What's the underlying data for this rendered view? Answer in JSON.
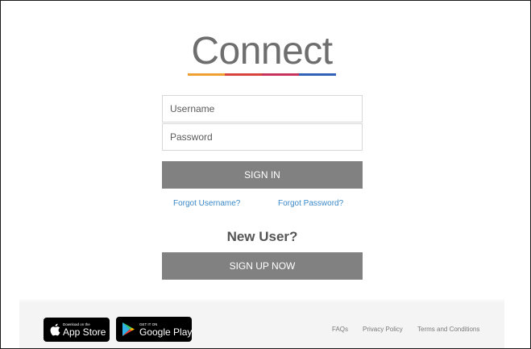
{
  "logo": {
    "text": "Connect",
    "bar_colors": [
      "#f0a030",
      "#d8433b",
      "#c8335c",
      "#2f62b8"
    ]
  },
  "login_form": {
    "username_placeholder": "Username",
    "password_placeholder": "Password",
    "sign_in_label": "SIGN IN",
    "forgot_username": "Forgot Username?",
    "forgot_password": "Forgot Password?"
  },
  "signup": {
    "heading": "New User?",
    "button_label": "SIGN UP NOW"
  },
  "footer": {
    "app_store": {
      "small": "Download on the",
      "big": "App Store",
      "icon": "apple-icon"
    },
    "google_play": {
      "small": "GET IT ON",
      "big": "Google Play",
      "icon": "google-play-icon"
    },
    "links": [
      "FAQs",
      "Privacy Policy",
      "Terms and Conditions"
    ]
  },
  "colors": {
    "button_bg": "#818181",
    "link": "#3a88c8",
    "footer_bg": "#f4f4f4"
  }
}
